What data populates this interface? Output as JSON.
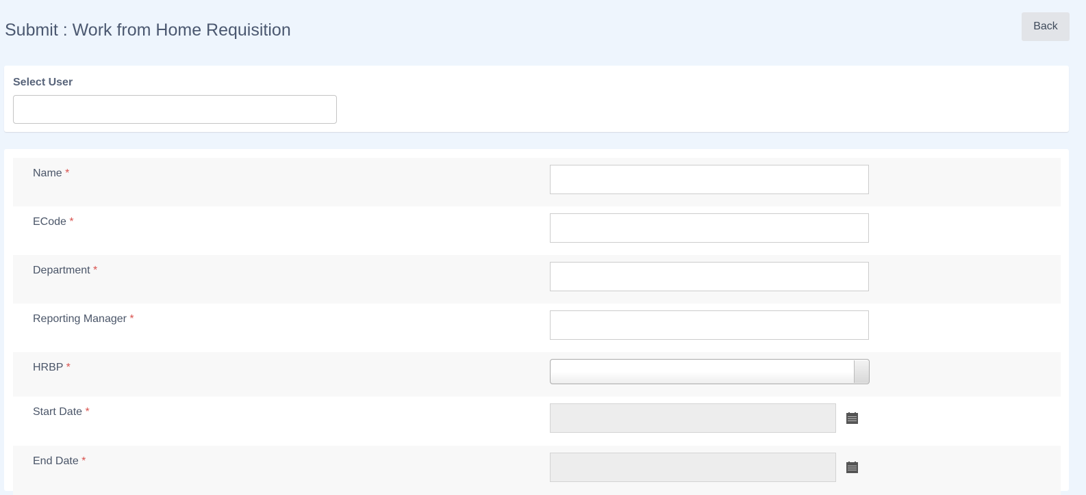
{
  "header": {
    "title": "Submit : Work from Home Requisition",
    "back_label": "Back"
  },
  "select_user": {
    "label": "Select User",
    "value": ""
  },
  "form": {
    "required_mark": "*",
    "fields": [
      {
        "label": "Name",
        "value": ""
      },
      {
        "label": "ECode",
        "value": ""
      },
      {
        "label": "Department",
        "value": ""
      },
      {
        "label": "Reporting Manager",
        "value": ""
      },
      {
        "label": "HRBP",
        "value": ""
      },
      {
        "label": "Start Date",
        "value": ""
      },
      {
        "label": "End Date",
        "value": ""
      }
    ]
  }
}
